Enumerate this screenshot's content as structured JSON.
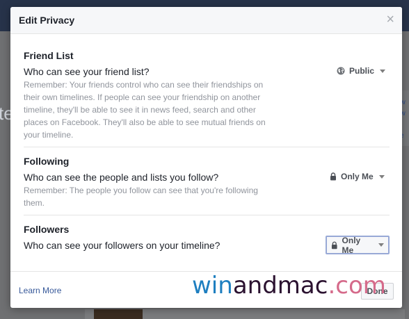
{
  "background": {
    "letters": "te",
    "right_text": [
      "ow",
      "ew",
      "lit",
      "ke"
    ]
  },
  "dialog": {
    "title": "Edit Privacy",
    "close": "×"
  },
  "sections": [
    {
      "title": "Friend List",
      "question": "Who can see your friend list?",
      "remark": "Remember: Your friends control who can see their friendships on their own timelines. If people can see your friendship on another timeline, they'll be able to see it in news feed, search and other places on Facebook. They'll also be able to see mutual friends on your timeline.",
      "audience": "Public",
      "audience_icon": "globe-icon"
    },
    {
      "title": "Following",
      "question": "Who can see the people and lists you follow?",
      "remark": "Remember: The people you follow can see that you're following them.",
      "audience": "Only Me",
      "audience_icon": "lock-icon"
    },
    {
      "title": "Followers",
      "question": "Who can see your followers on your timeline?",
      "remark": "",
      "audience": "Only Me",
      "audience_icon": "lock-icon"
    }
  ],
  "footer": {
    "learn_more": "Learn More",
    "done": "Done"
  },
  "watermark": {
    "part1": "win",
    "part2": "and",
    "part3": "mac",
    "part4": ".com"
  },
  "colors": {
    "link": "#365899",
    "focus_border": "#98a9d6",
    "topbar": "#27334a"
  }
}
